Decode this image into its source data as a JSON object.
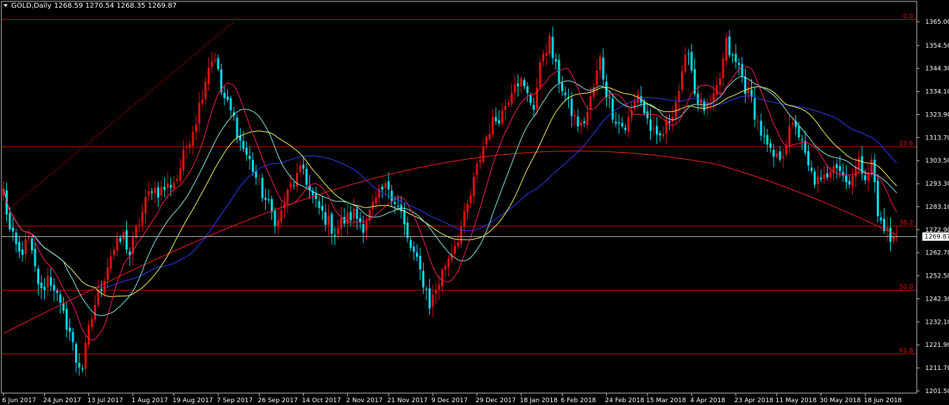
{
  "header": {
    "symbol_label": "GOLD,Daily",
    "ohlc": "1268.59 1270.54 1268.35 1269.87"
  },
  "colors": {
    "background": "#000000",
    "frame": "#c0c0c0",
    "bull_candle": "#e01010",
    "bear_candle": "#00e0f0",
    "fib_line": "#d00000",
    "ma_fast": "#ff1f5a",
    "ma_short": "#8ff0f0",
    "ma_mid": "#ffff60",
    "ma_long": "#3040ff",
    "ma_slow": "#ff2020",
    "current_price_line": "#c0c0c0"
  },
  "chart_data": {
    "type": "candlestick",
    "symbol": "GOLD",
    "timeframe": "Daily",
    "ylim": [
      1201.5,
      1367.5
    ],
    "y_ticks": [
      1365.0,
      1354.5,
      1344.3,
      1334.1,
      1323.9,
      1313.7,
      1303.5,
      1293.3,
      1283.1,
      1272.9,
      1262.7,
      1252.5,
      1242.3,
      1232.1,
      1221.9,
      1211.7,
      1201.5
    ],
    "y_tick_labels": [
      "1365.00",
      "1354.50",
      "1344.30",
      "1334.10",
      "1323.90",
      "1313.70",
      "1303.50",
      "1293.30",
      "1283.10",
      "1272.90",
      "1262.70",
      "1252.50",
      "1242.30",
      "1232.10",
      "1221.90",
      "1211.70",
      "1201.50"
    ],
    "x_tick_labels": [
      "6 Jun 2017",
      "24 Jun 2017",
      "13 Jul 2017",
      "1 Aug 2017",
      "19 Aug 2017",
      "7 Sep 2017",
      "26 Sep 2017",
      "14 Oct 2017",
      "2 Nov 2017",
      "21 Nov 2017",
      "9 Dec 2017",
      "29 Dec 2017",
      "18 Jan 2018",
      "6 Feb 2018",
      "24 Feb 2018",
      "15 Mar 2018",
      "4 Apr 2018",
      "23 Apr 2018",
      "11 May 2018",
      "30 May 2018",
      "18 Jun 2018"
    ],
    "x_tick_index": [
      0,
      13,
      27,
      41,
      54,
      68,
      81,
      95,
      109,
      122,
      136,
      150,
      164,
      177,
      191,
      204,
      218,
      232,
      245,
      259,
      273
    ],
    "current_price": 1269.87,
    "current_price_label": "1269.87",
    "fibonacci": {
      "levels": [
        {
          "label": "0.0",
          "price": 1366.0
        },
        {
          "label": "23.6",
          "price": 1309.6
        },
        {
          "label": "38.2",
          "price": 1274.5
        },
        {
          "label": "50.0",
          "price": 1246.1
        },
        {
          "label": "61.8",
          "price": 1218.0
        }
      ],
      "trendline": {
        "from_index": 0,
        "from_price": 1280,
        "to_index": 73,
        "to_price": 1365.0
      }
    },
    "anchors": [
      [
        0,
        1290
      ],
      [
        2,
        1272
      ],
      [
        5,
        1262
      ],
      [
        8,
        1268
      ],
      [
        10,
        1255
      ],
      [
        12,
        1245
      ],
      [
        14,
        1252
      ],
      [
        16,
        1248
      ],
      [
        18,
        1238
      ],
      [
        21,
        1228
      ],
      [
        23,
        1215
      ],
      [
        25,
        1212
      ],
      [
        27,
        1228
      ],
      [
        29,
        1240
      ],
      [
        31,
        1248
      ],
      [
        34,
        1262
      ],
      [
        36,
        1266
      ],
      [
        38,
        1270
      ],
      [
        40,
        1262
      ],
      [
        42,
        1272
      ],
      [
        45,
        1285
      ],
      [
        47,
        1292
      ],
      [
        49,
        1290
      ],
      [
        52,
        1292
      ],
      [
        55,
        1296
      ],
      [
        58,
        1310
      ],
      [
        61,
        1322
      ],
      [
        63,
        1334
      ],
      [
        65,
        1346
      ],
      [
        67,
        1350
      ],
      [
        69,
        1334
      ],
      [
        71,
        1328
      ],
      [
        73,
        1322
      ],
      [
        75,
        1312
      ],
      [
        77,
        1306
      ],
      [
        79,
        1300
      ],
      [
        81,
        1292
      ],
      [
        83,
        1286
      ],
      [
        85,
        1280
      ],
      [
        87,
        1276
      ],
      [
        89,
        1285
      ],
      [
        91,
        1292
      ],
      [
        93,
        1296
      ],
      [
        95,
        1300
      ],
      [
        97,
        1290
      ],
      [
        99,
        1284
      ],
      [
        101,
        1280
      ],
      [
        103,
        1276
      ],
      [
        105,
        1272
      ],
      [
        107,
        1276
      ],
      [
        109,
        1278
      ],
      [
        111,
        1280
      ],
      [
        114,
        1275
      ],
      [
        117,
        1283
      ],
      [
        120,
        1290
      ],
      [
        122,
        1292
      ],
      [
        124,
        1286
      ],
      [
        126,
        1280
      ],
      [
        128,
        1268
      ],
      [
        130,
        1262
      ],
      [
        132,
        1254
      ],
      [
        134,
        1246
      ],
      [
        135,
        1240
      ],
      [
        136,
        1243
      ],
      [
        138,
        1250
      ],
      [
        140,
        1258
      ],
      [
        142,
        1264
      ],
      [
        144,
        1270
      ],
      [
        146,
        1278
      ],
      [
        148,
        1288
      ],
      [
        150,
        1300
      ],
      [
        152,
        1310
      ],
      [
        154,
        1318
      ],
      [
        156,
        1322
      ],
      [
        158,
        1325
      ],
      [
        160,
        1332
      ],
      [
        162,
        1340
      ],
      [
        164,
        1338
      ],
      [
        166,
        1332
      ],
      [
        168,
        1328
      ],
      [
        171,
        1352
      ],
      [
        173,
        1356
      ],
      [
        175,
        1344
      ],
      [
        177,
        1336
      ],
      [
        179,
        1328
      ],
      [
        181,
        1322
      ],
      [
        183,
        1318
      ],
      [
        185,
        1325
      ],
      [
        187,
        1336
      ],
      [
        189,
        1348
      ],
      [
        191,
        1334
      ],
      [
        193,
        1325
      ],
      [
        195,
        1320
      ],
      [
        197,
        1318
      ],
      [
        199,
        1325
      ],
      [
        201,
        1334
      ],
      [
        203,
        1325
      ],
      [
        205,
        1318
      ],
      [
        207,
        1312
      ],
      [
        209,
        1316
      ],
      [
        211,
        1322
      ],
      [
        213,
        1330
      ],
      [
        215,
        1340
      ],
      [
        217,
        1354
      ],
      [
        219,
        1334
      ],
      [
        221,
        1328
      ],
      [
        223,
        1326
      ],
      [
        225,
        1330
      ],
      [
        227,
        1340
      ],
      [
        229,
        1355
      ],
      [
        231,
        1348
      ],
      [
        233,
        1345
      ],
      [
        235,
        1336
      ],
      [
        237,
        1330
      ],
      [
        239,
        1320
      ],
      [
        241,
        1312
      ],
      [
        243,
        1306
      ],
      [
        245,
        1304
      ],
      [
        247,
        1308
      ],
      [
        249,
        1316
      ],
      [
        251,
        1320
      ],
      [
        253,
        1310
      ],
      [
        255,
        1300
      ],
      [
        257,
        1295
      ],
      [
        259,
        1293
      ],
      [
        261,
        1298
      ],
      [
        263,
        1304
      ],
      [
        265,
        1300
      ],
      [
        267,
        1294
      ],
      [
        269,
        1298
      ],
      [
        271,
        1302
      ],
      [
        273,
        1298
      ],
      [
        275,
        1302
      ],
      [
        276,
        1294
      ],
      [
        277,
        1278
      ],
      [
        279,
        1275
      ],
      [
        280,
        1272
      ],
      [
        281,
        1268
      ],
      [
        283,
        1269.87
      ]
    ],
    "ma_periods": {
      "fast": 10,
      "short": 20,
      "mid": 30,
      "long": 50,
      "slow": 200
    }
  }
}
